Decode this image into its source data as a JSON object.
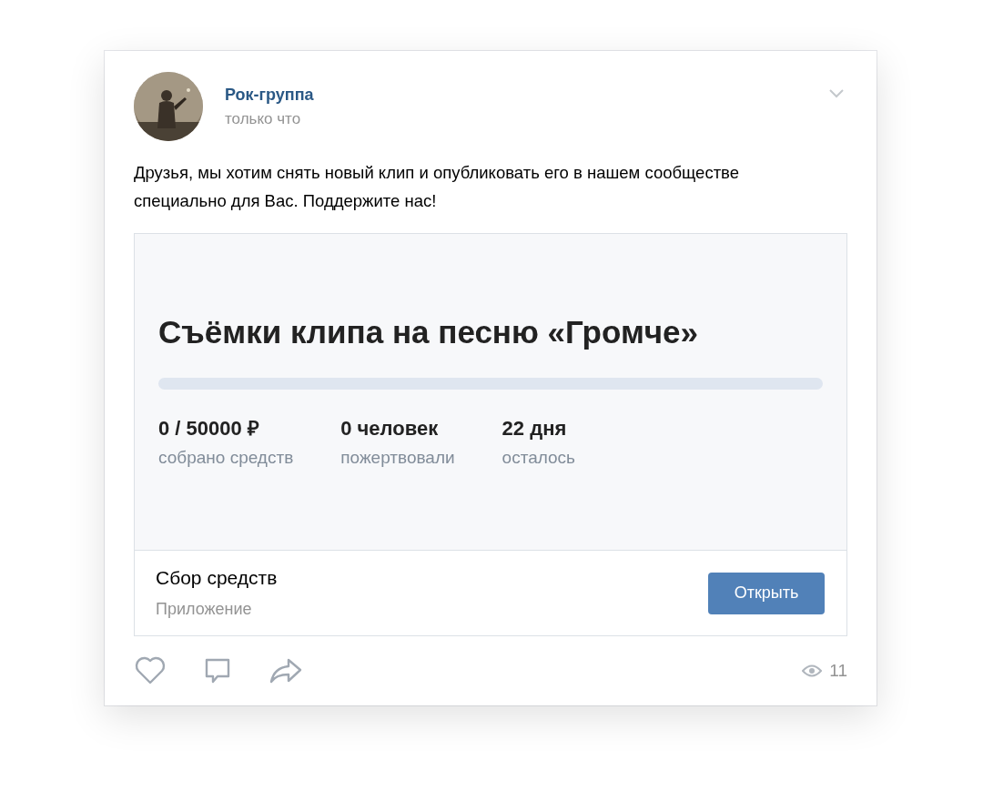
{
  "post": {
    "author": "Рок-группа",
    "time": "только что",
    "text": "Друзья, мы хотим снять новый клип и опубликовать его в нашем сообществе специально для Вас. Поддержите нас!",
    "fundraiser": {
      "title": "Съёмки клипа на песню «Громче»",
      "progress": {
        "level": 0
      },
      "stats": [
        {
          "value": "0 / 50000 ₽",
          "label": "собрано средств"
        },
        {
          "value": "0 человек",
          "label": "пожертвовали"
        },
        {
          "value": "22 дня",
          "label": "осталось"
        }
      ],
      "app_name": "Сбор средств",
      "app_type": "Приложение",
      "button": "Открыть"
    },
    "views": "11"
  }
}
